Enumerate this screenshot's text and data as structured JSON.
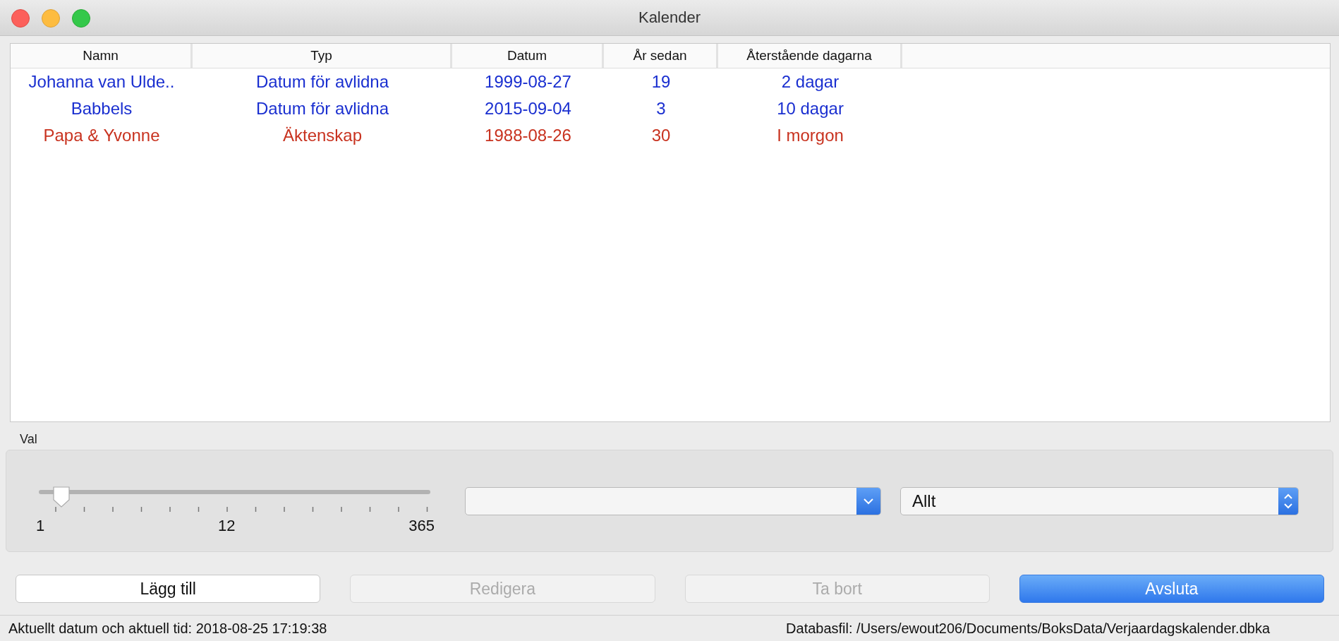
{
  "window": {
    "title": "Kalender"
  },
  "table": {
    "columns": [
      "Namn",
      "Typ",
      "Datum",
      "År sedan",
      "Återstående dagarna"
    ],
    "rows": [
      {
        "color": "#1a2fd0",
        "cells": [
          "Johanna van Ulde..",
          "Datum för avlidna",
          "1999-08-27",
          "19",
          "2 dagar"
        ]
      },
      {
        "color": "#1a2fd0",
        "cells": [
          "Babbels",
          "Datum för avlidna",
          "2015-09-04",
          "3",
          "10 dagar"
        ]
      },
      {
        "color": "#c8321f",
        "cells": [
          "Papa & Yvonne",
          "Äktenskap",
          "1988-08-26",
          "30",
          "I morgon"
        ]
      }
    ]
  },
  "options": {
    "label": "Val",
    "slider": {
      "level": 0.055,
      "tick_labels": [
        "1",
        "12",
        "365"
      ]
    },
    "filter_select": {
      "value": "Allt"
    }
  },
  "buttons": [
    {
      "label": "Lägg till",
      "disabled": false,
      "default": false
    },
    {
      "label": "Redigera",
      "disabled": true,
      "default": false
    },
    {
      "label": "Ta bort",
      "disabled": true,
      "default": false
    },
    {
      "label": "Avsluta",
      "disabled": false,
      "default": true
    }
  ],
  "status_bar": {
    "left": "Aktuellt datum och aktuell tid: 2018-08-25 17:19:38",
    "right": "Databasfil: /Users/ewout206/Documents/BoksData/Verjaardagskalender.dbka"
  }
}
